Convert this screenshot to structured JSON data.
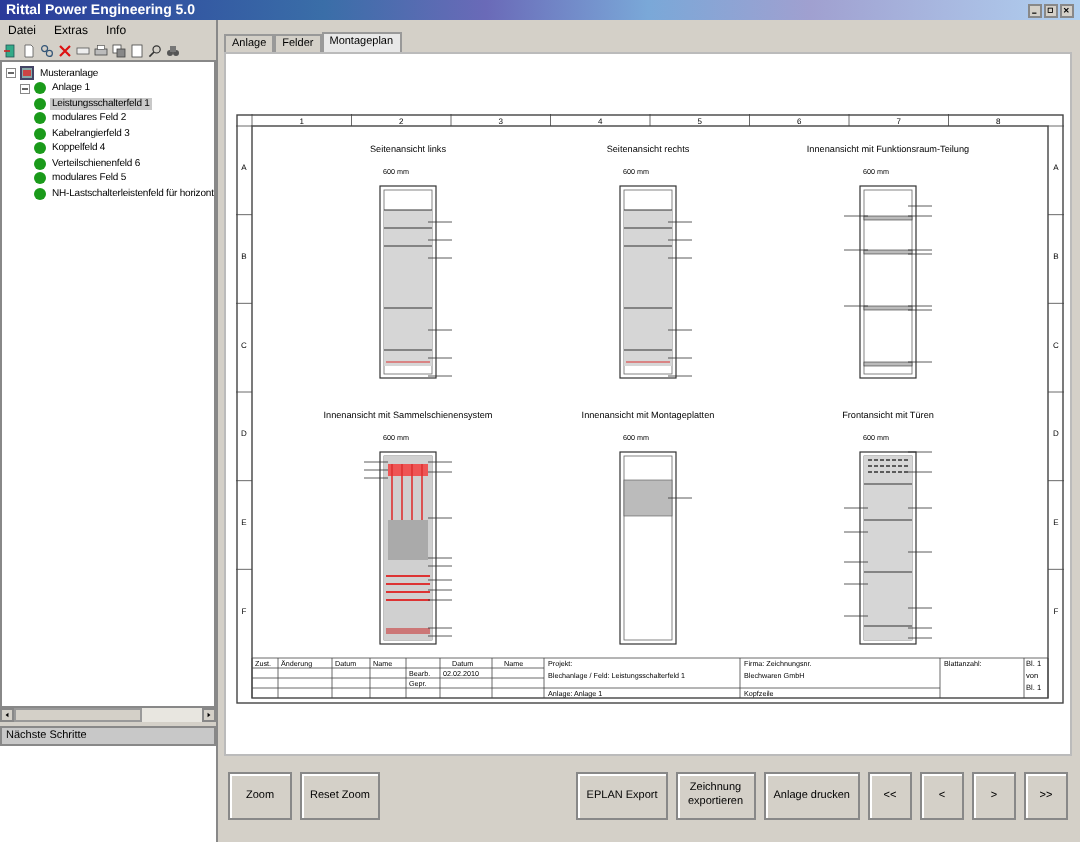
{
  "window": {
    "title": "Rittal Power Engineering 5.0"
  },
  "menu": [
    "Datei",
    "Extras",
    "Info"
  ],
  "tree": {
    "label": "Musteranlage",
    "expanded": true,
    "children": [
      {
        "label": "Anlage 1",
        "expanded": true,
        "children": [
          {
            "label": "Leistungsschalterfeld 1",
            "selected": true
          },
          {
            "label": "modulares Feld 2",
            "selected": false
          },
          {
            "label": "Kabelrangierfeld 3",
            "selected": false
          },
          {
            "label": "Koppelfeld 4",
            "selected": false
          },
          {
            "label": "Verteilschienenfeld 6",
            "selected": false
          },
          {
            "label": "modulares Feld 5",
            "selected": false
          },
          {
            "label": "NH-Lastschalterleistenfeld für horizont",
            "selected": false
          }
        ]
      }
    ]
  },
  "next_steps": {
    "title": "Nächste Schritte"
  },
  "tabs": [
    {
      "label": "Anlage",
      "selected": false
    },
    {
      "label": "Felder",
      "selected": false
    },
    {
      "label": "Montageplan",
      "selected": true
    }
  ],
  "drawing": {
    "columns": [
      "1",
      "2",
      "3",
      "4",
      "5",
      "6",
      "7",
      "8"
    ],
    "rows": [
      "A",
      "B",
      "C",
      "D",
      "E",
      "F"
    ],
    "rows_right": [
      "A",
      "B",
      "C",
      "D",
      "E",
      "F"
    ],
    "views": [
      {
        "title": "Seitenansicht links",
        "width": "600 mm",
        "kind": "side"
      },
      {
        "title": "Seitenansicht rechts",
        "width": "600 mm",
        "kind": "side"
      },
      {
        "title": "Innenansicht mit Funktionsraum-Teilung",
        "width": "600 mm",
        "kind": "interior"
      },
      {
        "title": "Innenansicht mit Sammelschienensystem",
        "width": "600 mm",
        "kind": "busbar"
      },
      {
        "title": "Innenansicht mit Montageplatten",
        "width": "600 mm",
        "kind": "plate"
      },
      {
        "title": "Frontansicht mit Türen",
        "width": "600 mm",
        "kind": "front"
      }
    ],
    "title_block": {
      "revision_headers": [
        "Zust.",
        "Änderung",
        "Datum",
        "Name"
      ],
      "date_header": "Datum",
      "name_header": "Name",
      "edited": "Bearb.",
      "checked": "Gepr.",
      "date": "02.02.2010",
      "project_label": "Projekt:",
      "project": "Blechanlage / Feld: Leistungsschalterfeld 1",
      "plant": "Anlage:   Anlage 1",
      "company_label": "Firma: Zeichnungsnr.",
      "company": "Blechwaren GmbH",
      "header_line": "Kopfzeile",
      "sheets_label": "Blattanzahl:",
      "sheet": "Bl. 1",
      "of": "von",
      "total": "Bl. 1"
    }
  },
  "buttons_left": [
    "Zoom",
    "Reset Zoom"
  ],
  "buttons_right": [
    "EPLAN Export",
    "Zeichnung exportieren",
    "Anlage drucken",
    "<<",
    "<",
    ">",
    ">>"
  ]
}
